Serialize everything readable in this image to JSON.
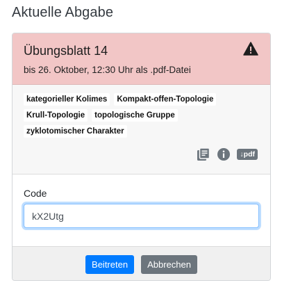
{
  "page": {
    "title": "Aktuelle Abgabe"
  },
  "assignment": {
    "title": "Übungsblatt 14",
    "deadline": "bis 26. Oktober, 12:30 Uhr als .pdf-Datei",
    "warning_icon": "warning-triangle-icon",
    "header_color": "#f2c6c6"
  },
  "tags": [
    "kategorieller Kolimes",
    "Kompakt-offen-Topologie",
    "Krull-Topologie",
    "topologische Gruppe",
    "zyklotomischer Charakter"
  ],
  "tools": {
    "icons": [
      "sheets-icon",
      "info-icon",
      "pdf-download-icon"
    ],
    "pdf_label": "↓pdf"
  },
  "form": {
    "code_label": "Code",
    "code_value": "kX2Utg"
  },
  "buttons": {
    "join": "Beitreten",
    "cancel": "Abbrechen"
  },
  "colors": {
    "primary": "#007bff",
    "secondary": "#6c757d"
  }
}
